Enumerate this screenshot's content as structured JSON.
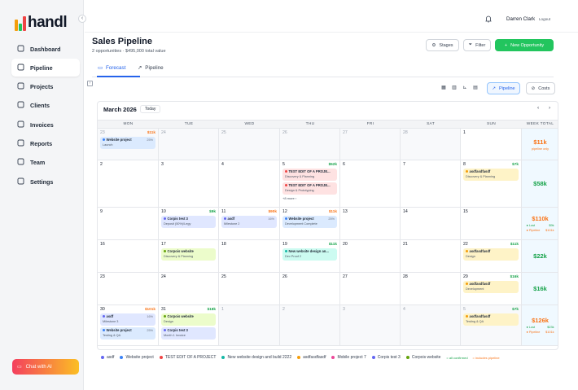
{
  "brand": {
    "name": "handl"
  },
  "sidebar": {
    "items": [
      {
        "label": "Dashboard",
        "icon": "dashboard-grid-icon",
        "active": false
      },
      {
        "label": "Pipeline",
        "icon": "trend-up-icon",
        "active": true
      },
      {
        "label": "Projects",
        "icon": "briefcase-icon",
        "active": false
      },
      {
        "label": "Clients",
        "icon": "users-icon",
        "active": false
      },
      {
        "label": "Invoices",
        "icon": "dollar-doc-icon",
        "active": false
      },
      {
        "label": "Reports",
        "icon": "bar-chart-icon",
        "active": false
      },
      {
        "label": "Team",
        "icon": "user-icon",
        "active": false
      },
      {
        "label": "Settings",
        "icon": "gear-icon",
        "active": false
      }
    ],
    "chat_label": "Chat with AI"
  },
  "topbar": {
    "user": "Darren Clark",
    "logout": "Logout"
  },
  "header": {
    "title": "Sales Pipeline",
    "subtitle": "2 opportunities · $495,000 total value",
    "stages": "Stages",
    "filter": "Filter",
    "new": "New Opportunity"
  },
  "tabs": {
    "forecast": "Forecast",
    "pipeline": "Pipeline"
  },
  "viewbar": {
    "pipeline": "Pipeline",
    "costs": "Costs"
  },
  "calendar": {
    "month": "March 2026",
    "today": "Today",
    "headers": [
      "MON",
      "TUE",
      "WED",
      "THU",
      "FRI",
      "SAT",
      "SUN",
      "WEEK TOTAL"
    ]
  },
  "weeks": [
    {
      "days": [
        {
          "n": "23",
          "out": true,
          "amt": "$11k",
          "amtc": "#f97316",
          "events": [
            {
              "t": "Website project",
              "s": "Launch",
              "p": "25%",
              "bg": "#dbeafe",
              "dot": "#3b82f6"
            }
          ]
        },
        {
          "n": "24",
          "out": true
        },
        {
          "n": "25",
          "out": true
        },
        {
          "n": "26",
          "out": true
        },
        {
          "n": "27",
          "out": true
        },
        {
          "n": "28",
          "out": true
        },
        {
          "n": "1",
          "out": false
        }
      ],
      "total": {
        "big": "$11k",
        "color": "#f97316",
        "sub": "pipeline only",
        "lost": "",
        "pipe": ""
      }
    },
    {
      "days": [
        {
          "n": "2"
        },
        {
          "n": "3"
        },
        {
          "n": "4"
        },
        {
          "n": "5",
          "amt": "$52k",
          "amtc": "#16a34a",
          "events": [
            {
              "t": "TEST EDIT OF A PROJE...",
              "s": "Discovery & Planning",
              "p": "",
              "bg": "#fee2e2",
              "dot": "#ef4444"
            },
            {
              "t": "TEST EDIT OF A PROJE...",
              "s": "Design & Prototyping",
              "p": "",
              "bg": "#fee2e2",
              "dot": "#ef4444"
            }
          ],
          "more": "+8 more ›"
        },
        {
          "n": "6"
        },
        {
          "n": "7"
        },
        {
          "n": "8",
          "amt": "$7k",
          "amtc": "#16a34a",
          "events": [
            {
              "t": "asdfasdfasdf",
              "s": "Discovery & Planning",
              "p": "",
              "bg": "#fef3c7",
              "dot": "#f59e0b"
            }
          ]
        }
      ],
      "total": {
        "big": "$58k",
        "color": "#16a34a",
        "sub": "",
        "lost": "",
        "pipe": ""
      }
    },
    {
      "days": [
        {
          "n": "9"
        },
        {
          "n": "10",
          "amt": "$9k",
          "amtc": "#16a34a",
          "events": [
            {
              "t": "Corpis test 3",
              "s": "Deposit (50%)/Legy",
              "p": "",
              "bg": "#e0e7ff",
              "dot": "#6366f1"
            }
          ]
        },
        {
          "n": "11",
          "amt": "$90k",
          "amtc": "#f97316",
          "events": [
            {
              "t": "asdf",
              "s": "Milestone 2",
              "p": "16%",
              "bg": "#e0e7ff",
              "dot": "#6366f1"
            }
          ]
        },
        {
          "n": "12",
          "amt": "$11k",
          "amtc": "#f97316",
          "events": [
            {
              "t": "Website project",
              "s": "Development Complete",
              "p": "25%",
              "bg": "#dbeafe",
              "dot": "#3b82f6"
            }
          ]
        },
        {
          "n": "13"
        },
        {
          "n": "14"
        },
        {
          "n": "15"
        }
      ],
      "total": {
        "big": "$110k",
        "color": "#f97316",
        "sub": "",
        "lost": "$9k",
        "pipe": "$101k"
      }
    },
    {
      "days": [
        {
          "n": "16"
        },
        {
          "n": "17",
          "events": [
            {
              "t": "Corpois website",
              "s": "Discovery & Planning",
              "p": "",
              "bg": "#ecfccb",
              "dot": "#65a30d"
            }
          ]
        },
        {
          "n": "18"
        },
        {
          "n": "19",
          "amt": "$11k",
          "amtc": "#16a34a",
          "events": [
            {
              "t": "New website design an...",
              "s": "Dev Proof 2",
              "p": "",
              "bg": "#ccfbf1",
              "dot": "#14b8a6"
            }
          ]
        },
        {
          "n": "20"
        },
        {
          "n": "21"
        },
        {
          "n": "22",
          "amt": "$11k",
          "amtc": "#16a34a",
          "events": [
            {
              "t": "asdfasdfasdf",
              "s": "Design",
              "p": "",
              "bg": "#fef3c7",
              "dot": "#f59e0b"
            }
          ]
        }
      ],
      "total": {
        "big": "$22k",
        "color": "#16a34a",
        "sub": "",
        "lost": "",
        "pipe": ""
      }
    },
    {
      "days": [
        {
          "n": "23"
        },
        {
          "n": "24"
        },
        {
          "n": "25"
        },
        {
          "n": "26"
        },
        {
          "n": "27"
        },
        {
          "n": "28"
        },
        {
          "n": "29",
          "amt": "$16k",
          "amtc": "#16a34a",
          "events": [
            {
              "t": "asdfasdfasdf",
              "s": "Development",
              "p": "",
              "bg": "#fef3c7",
              "dot": "#f59e0b"
            }
          ]
        }
      ],
      "total": {
        "big": "$16k",
        "color": "#16a34a",
        "sub": "",
        "lost": "",
        "pipe": ""
      }
    },
    {
      "days": [
        {
          "n": "30",
          "amt": "$101k",
          "amtc": "#f97316",
          "events": [
            {
              "t": "asdf",
              "s": "Milestone 3",
              "p": "16%",
              "bg": "#e0e7ff",
              "dot": "#6366f1"
            },
            {
              "t": "Website project",
              "s": "Testing & QA",
              "p": "25%",
              "bg": "#dbeafe",
              "dot": "#3b82f6"
            }
          ]
        },
        {
          "n": "31",
          "amt": "$18k",
          "amtc": "#16a34a",
          "events": [
            {
              "t": "Corpois website",
              "s": "Design",
              "p": "",
              "bg": "#ecfccb",
              "dot": "#65a30d"
            },
            {
              "t": "Corpis test 3",
              "s": "Month 1 Invoice",
              "p": "",
              "bg": "#e0e7ff",
              "dot": "#6366f1"
            }
          ]
        },
        {
          "n": "1",
          "out": true
        },
        {
          "n": "2",
          "out": true
        },
        {
          "n": "3",
          "out": true
        },
        {
          "n": "4",
          "out": true
        },
        {
          "n": "5",
          "out": true,
          "amt": "$7k",
          "amtc": "#16a34a",
          "events": [
            {
              "t": "asdfasdfasdf",
              "s": "Testing & QA",
              "p": "",
              "bg": "#fef3c7",
              "dot": "#f59e0b"
            }
          ]
        }
      ],
      "total": {
        "big": "$126k",
        "color": "#f97316",
        "sub": "",
        "lost": "$23k",
        "pipe": "$101k"
      }
    }
  ],
  "week_labels": {
    "lost": "Lost",
    "pipeline": "Pipeline"
  },
  "legend": {
    "items": [
      {
        "label": "asdf",
        "color": "#6366f1"
      },
      {
        "label": "Website project",
        "color": "#3b82f6"
      },
      {
        "label": "TEST EDIT OF A PROJECT",
        "color": "#ef4444"
      },
      {
        "label": "New website design and build 2222",
        "color": "#14b8a6"
      },
      {
        "label": "asdfasdfasdf",
        "color": "#f59e0b"
      },
      {
        "label": "Mobile project 7",
        "color": "#ec4899"
      },
      {
        "label": "Corpis test 3",
        "color": "#6366f1"
      },
      {
        "label": "Corpois website",
        "color": "#65a30d"
      }
    ],
    "confirmed": "= all confirmed",
    "includes": "= includes pipeline"
  }
}
